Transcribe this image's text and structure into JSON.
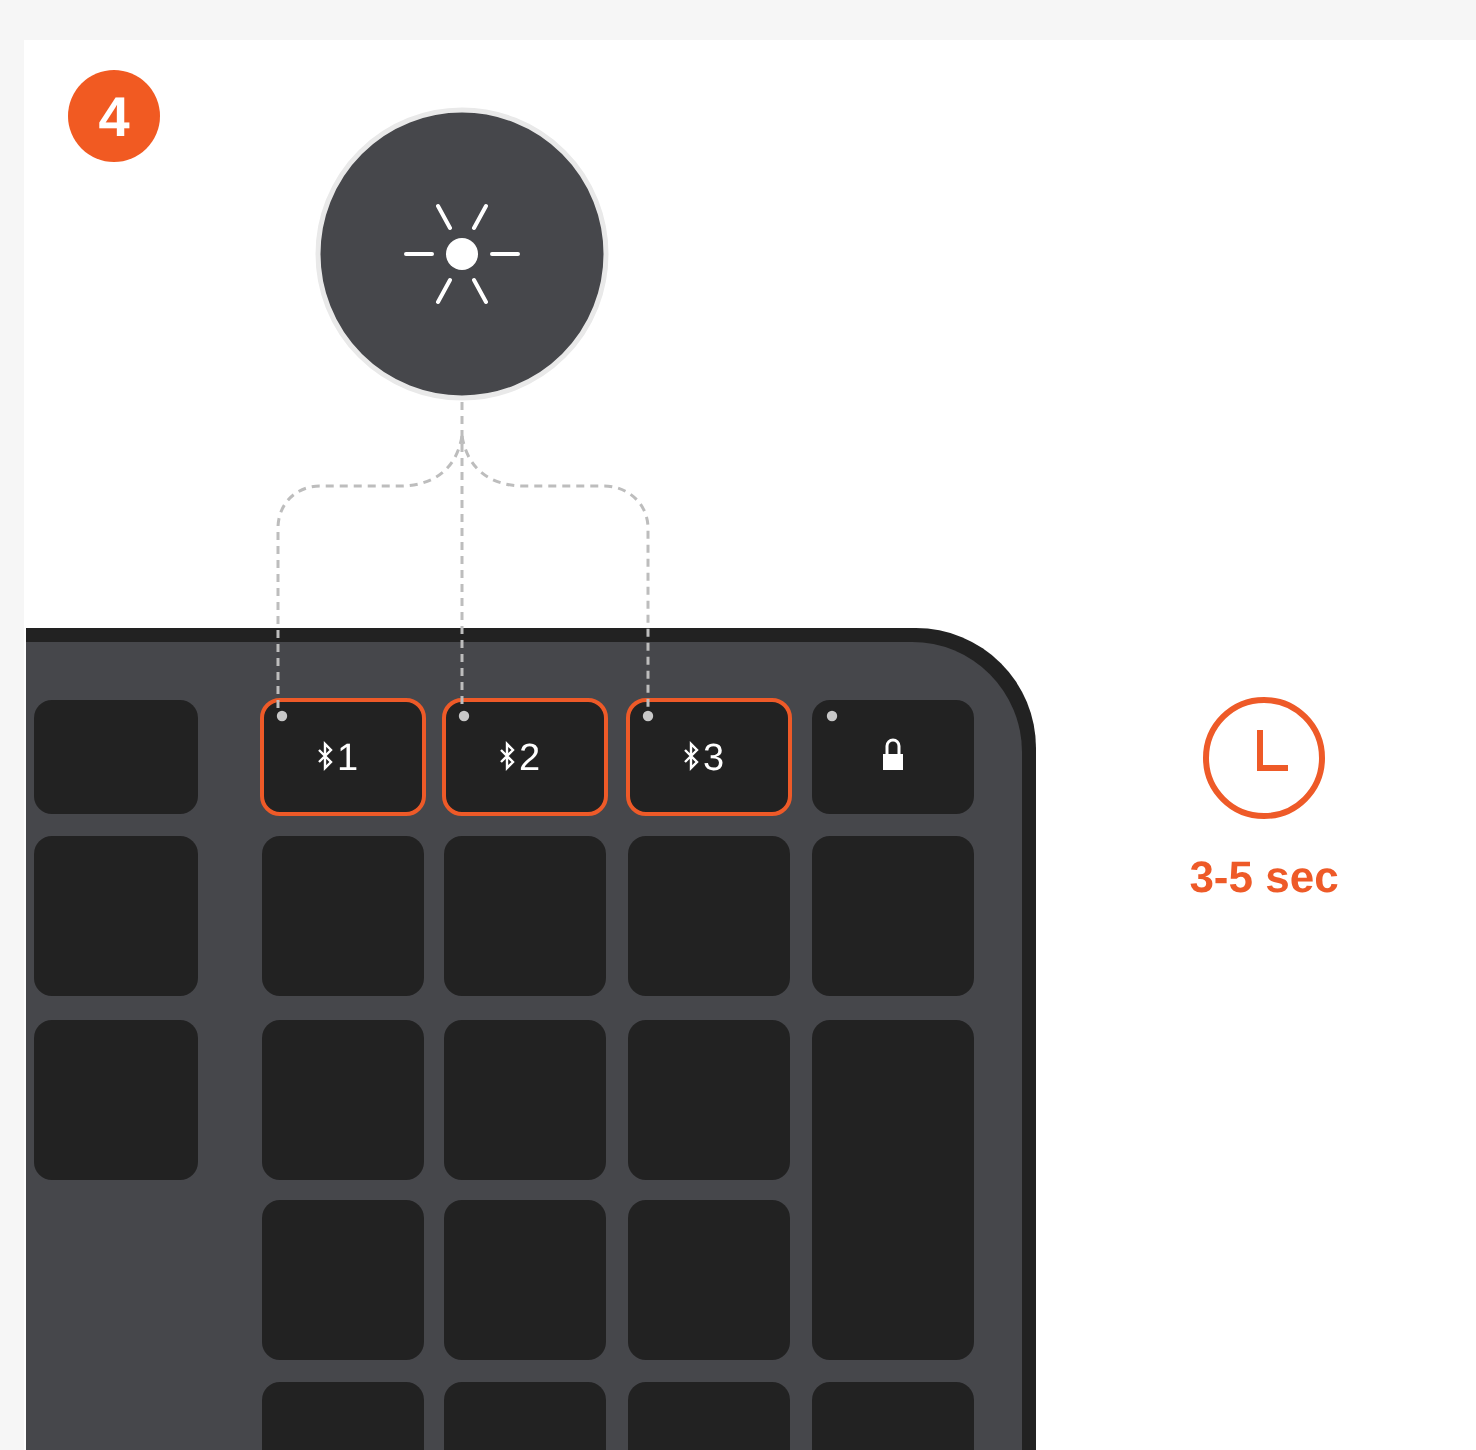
{
  "step": "4",
  "top_keys": [
    {
      "kind": "blank",
      "led": false,
      "highlighted": false
    },
    {
      "kind": "channel",
      "number": "1",
      "led": true,
      "highlighted": true
    },
    {
      "kind": "channel",
      "number": "2",
      "led": true,
      "highlighted": true
    },
    {
      "kind": "channel",
      "number": "3",
      "led": true,
      "highlighted": true
    },
    {
      "kind": "lock",
      "led": true,
      "highlighted": false
    }
  ],
  "timer": {
    "label": "3-5 sec"
  }
}
